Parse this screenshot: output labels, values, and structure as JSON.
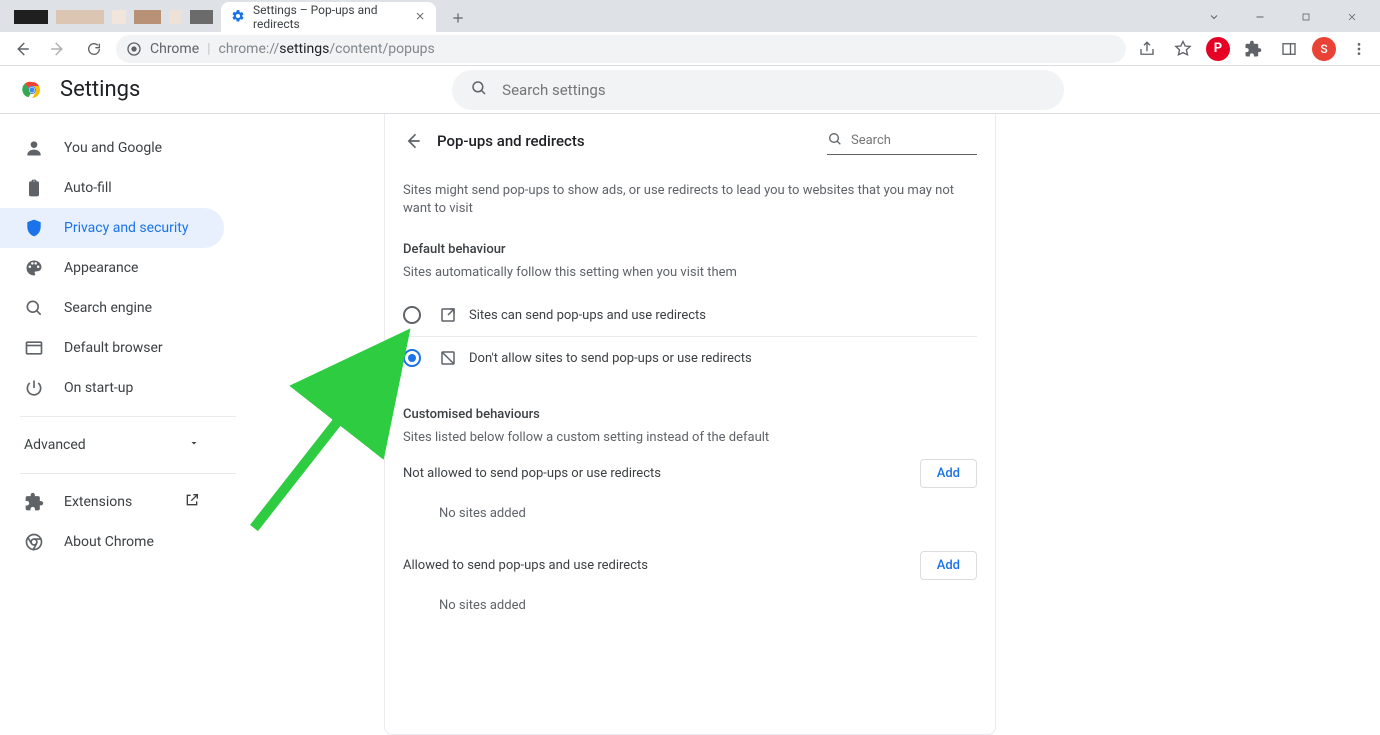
{
  "browser": {
    "tab_title": "Settings – Pop-ups and redirects",
    "omnibox_host_label": "Chrome",
    "omnibox_url_prefix": "chrome://",
    "omnibox_url_bold": "settings",
    "omnibox_url_suffix": "/content/popups",
    "avatar_letter": "S"
  },
  "header": {
    "title": "Settings",
    "search_placeholder": "Search settings"
  },
  "sidebar": {
    "items": [
      {
        "label": "You and Google"
      },
      {
        "label": "Auto-fill"
      },
      {
        "label": "Privacy and security"
      },
      {
        "label": "Appearance"
      },
      {
        "label": "Search engine"
      },
      {
        "label": "Default browser"
      },
      {
        "label": "On start-up"
      }
    ],
    "advanced_label": "Advanced",
    "extensions_label": "Extensions",
    "about_label": "About Chrome"
  },
  "content": {
    "title": "Pop-ups and redirects",
    "search_placeholder": "Search",
    "description": "Sites might send pop-ups to show ads, or use redirects to lead you to websites that you may not want to visit",
    "default_heading": "Default behaviour",
    "default_sub": "Sites automatically follow this setting when you visit them",
    "radio_allow": "Sites can send pop-ups and use redirects",
    "radio_block": "Don't allow sites to send pop-ups or use redirects",
    "custom_heading": "Customised behaviours",
    "custom_sub": "Sites listed below follow a custom setting instead of the default",
    "not_allowed_heading": "Not allowed to send pop-ups or use redirects",
    "allowed_heading": "Allowed to send pop-ups and use redirects",
    "add_label": "Add",
    "empty_label": "No sites added"
  }
}
